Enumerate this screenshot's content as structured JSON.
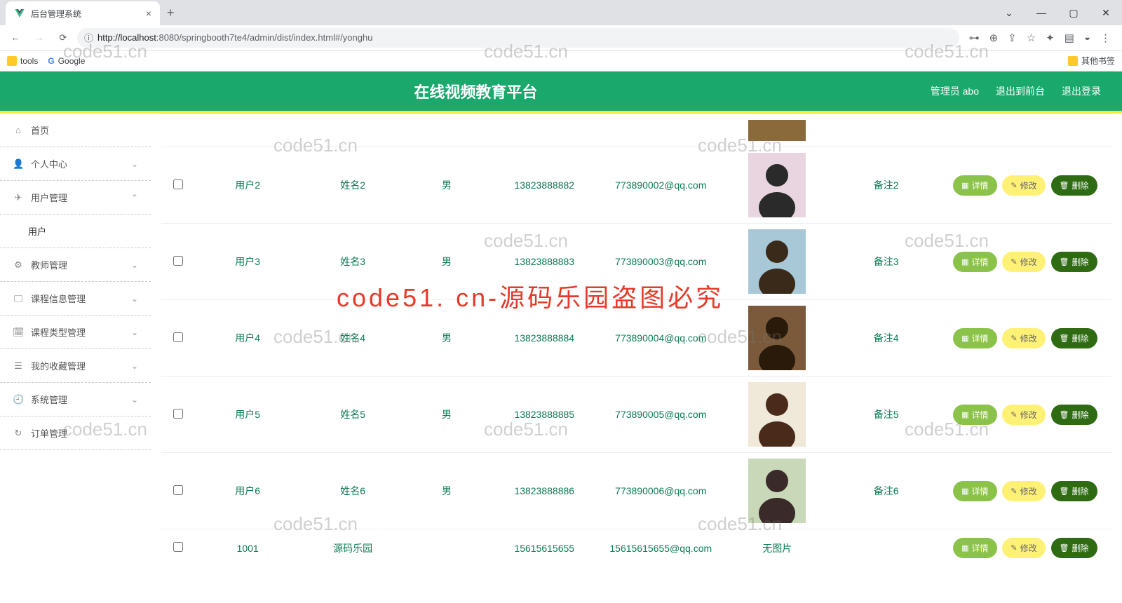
{
  "browser": {
    "tab_title": "后台管理系统",
    "url_prefix": "http://",
    "url_host": "localhost",
    "url_port_path": ":8080/springbooth7te4/admin/dist/index.html#/yonghu",
    "bookmarks": {
      "tools": "tools",
      "google": "Google",
      "other": "其他书签"
    }
  },
  "header": {
    "title": "在线视频教育平台",
    "admin_label": "管理员 abo",
    "to_front": "退出到前台",
    "logout": "退出登录"
  },
  "sidebar": {
    "home": "首页",
    "personal": "个人中心",
    "user_mgmt": "用户管理",
    "user_sub": "用户",
    "teacher_mgmt": "教师管理",
    "course_info": "课程信息管理",
    "course_type": "课程类型管理",
    "favorites": "我的收藏管理",
    "system": "系统管理",
    "order": "订单管理"
  },
  "table": {
    "btn_detail": "详情",
    "btn_edit": "修改",
    "btn_delete": "删除",
    "rows": [
      {
        "user": "用户2",
        "name": "姓名2",
        "gender": "男",
        "phone": "13823888882",
        "email": "773890002@qq.com",
        "remark": "备注2",
        "has_img": true
      },
      {
        "user": "用户3",
        "name": "姓名3",
        "gender": "男",
        "phone": "13823888883",
        "email": "773890003@qq.com",
        "remark": "备注3",
        "has_img": true
      },
      {
        "user": "用户4",
        "name": "姓名4",
        "gender": "男",
        "phone": "13823888884",
        "email": "773890004@qq.com",
        "remark": "备注4",
        "has_img": true
      },
      {
        "user": "用户5",
        "name": "姓名5",
        "gender": "男",
        "phone": "13823888885",
        "email": "773890005@qq.com",
        "remark": "备注5",
        "has_img": true
      },
      {
        "user": "用户6",
        "name": "姓名6",
        "gender": "男",
        "phone": "13823888886",
        "email": "773890006@qq.com",
        "remark": "备注6",
        "has_img": true
      },
      {
        "user": "1001",
        "name": "源码乐园",
        "gender": "",
        "phone": "15615615655",
        "email": "15615615655@qq.com",
        "remark": "",
        "has_img": false,
        "no_img_text": "无图片"
      }
    ]
  },
  "watermarks": {
    "small": "code51.cn",
    "big": "code51. cn-源码乐园盗图必究"
  }
}
